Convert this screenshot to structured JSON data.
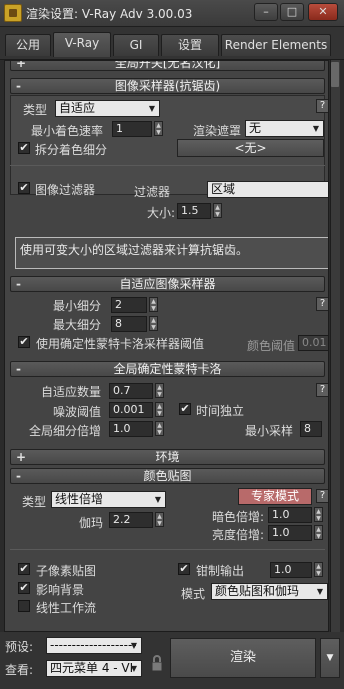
{
  "window": {
    "title": "渲染设置: V-Ray Adv 3.00.03",
    "minimize": "–",
    "maximize": "□",
    "close": "✕"
  },
  "tabs": [
    {
      "label": "公用",
      "active": false
    },
    {
      "label": "V-Ray",
      "active": true
    },
    {
      "label": "GI",
      "active": false
    },
    {
      "label": "设置",
      "active": false
    },
    {
      "label": "Render Elements",
      "active": false
    }
  ],
  "rollouts": {
    "global_switches": {
      "sign": "+",
      "title": "全局开关[无名汉化]"
    },
    "image_sampler": {
      "sign": "-",
      "title": "图像采样器(抗锯齿)"
    },
    "adaptive_sampler": {
      "sign": "-",
      "title": "自适应图像采样器"
    },
    "global_dmc": {
      "sign": "-",
      "title": "全局确定性蒙特卡洛"
    },
    "environment": {
      "sign": "+",
      "title": "环境"
    },
    "color_mapping": {
      "sign": "-",
      "title": "颜色贴图"
    }
  },
  "image_sampler": {
    "type_label": "类型",
    "type_value": "自适应",
    "min_shading_rate_label": "最小着色速率",
    "min_shading_rate": "1",
    "render_mask_label": "渲染遮罩",
    "render_mask_value": "无",
    "divide_shading_label": "拆分着色细分",
    "divide_shading_checked": true,
    "mask_button": "<无>",
    "help": "?"
  },
  "image_filter": {
    "enable_label": "图像过滤器",
    "enabled": true,
    "filter_label": "过滤器",
    "filter_value": "区域",
    "size_label": "大小:",
    "size": "1.5",
    "description": "使用可变大小的区域过滤器来计算抗锯齿。"
  },
  "adaptive": {
    "min_subdivs_label": "最小细分",
    "min_subdivs": "2",
    "max_subdivs_label": "最大细分",
    "max_subdivs": "8",
    "use_dmc_label": "使用确定性蒙特卡洛采样器阈值",
    "use_dmc_checked": true,
    "color_threshold_label": "颜色阈值",
    "color_threshold": "0.01",
    "help": "?"
  },
  "dmc": {
    "adaptive_amount_label": "自适应数量",
    "adaptive_amount": "0.7",
    "noise_threshold_label": "噪波阈值",
    "noise_threshold": "0.001",
    "time_independent_label": "时间独立",
    "time_independent_checked": true,
    "global_subdivs_label": "全局细分倍增",
    "global_subdivs": "1.0",
    "min_samples_label": "最小采样",
    "min_samples": "8",
    "help": "?"
  },
  "color_mapping": {
    "type_label": "类型",
    "type_value": "线性倍增",
    "expert_button": "专家模式",
    "gamma_label": "伽玛",
    "gamma": "2.2",
    "dark_mult_label": "暗色倍增:",
    "dark_mult": "1.0",
    "bright_mult_label": "亮度倍增:",
    "bright_mult": "1.0",
    "subpixel_label": "子像素贴图",
    "subpixel_checked": true,
    "clamp_label": "钳制输出",
    "clamp_checked": true,
    "clamp_value": "1.0",
    "affect_bg_label": "影响背景",
    "affect_bg_checked": true,
    "linear_workflow_label": "线性工作流",
    "linear_workflow_checked": false,
    "mode_label": "模式",
    "mode_value": "颜色贴图和伽玛",
    "help": "?"
  },
  "bottom": {
    "preset_label": "预设:",
    "preset_value": "--------------------",
    "view_label": "查看:",
    "view_value": "四元菜单 4 - VI",
    "render_button": "渲染"
  }
}
